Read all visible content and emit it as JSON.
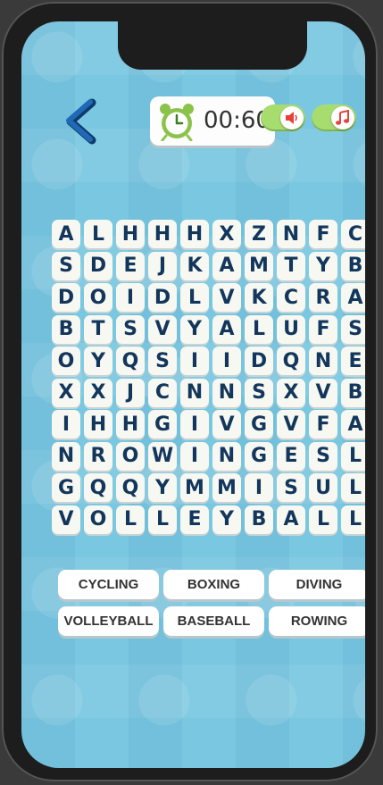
{
  "timer": {
    "time": "00:60"
  },
  "icons": {
    "back": "chevron-left-icon",
    "clock": "alarm-clock-icon",
    "sound": "speaker-icon",
    "music": "music-note-icon"
  },
  "colors": {
    "background": "#79c7e0",
    "tile": "#f7f8f2",
    "letter": "#12365c",
    "toggle_on": "#a7dc6f",
    "icon_red": "#e8413a"
  },
  "grid": [
    [
      "A",
      "L",
      "H",
      "H",
      "H",
      "X",
      "Z",
      "N",
      "F",
      "C"
    ],
    [
      "S",
      "D",
      "E",
      "J",
      "K",
      "A",
      "M",
      "T",
      "Y",
      "B"
    ],
    [
      "D",
      "O",
      "I",
      "D",
      "L",
      "V",
      "K",
      "C",
      "R",
      "A"
    ],
    [
      "B",
      "T",
      "S",
      "V",
      "Y",
      "A",
      "L",
      "U",
      "F",
      "S"
    ],
    [
      "O",
      "Y",
      "Q",
      "S",
      "I",
      "I",
      "D",
      "Q",
      "N",
      "E"
    ],
    [
      "X",
      "X",
      "J",
      "C",
      "N",
      "N",
      "S",
      "X",
      "V",
      "B"
    ],
    [
      "I",
      "H",
      "H",
      "G",
      "I",
      "V",
      "G",
      "V",
      "F",
      "A"
    ],
    [
      "N",
      "R",
      "O",
      "W",
      "I",
      "N",
      "G",
      "E",
      "S",
      "L"
    ],
    [
      "G",
      "Q",
      "Q",
      "Y",
      "M",
      "M",
      "I",
      "S",
      "U",
      "L"
    ],
    [
      "V",
      "O",
      "L",
      "L",
      "E",
      "Y",
      "B",
      "A",
      "L",
      "L"
    ]
  ],
  "words": [
    "CYCLING",
    "BOXING",
    "DIVING",
    "VOLLEYBALL",
    "BASEBALL",
    "ROWING"
  ]
}
